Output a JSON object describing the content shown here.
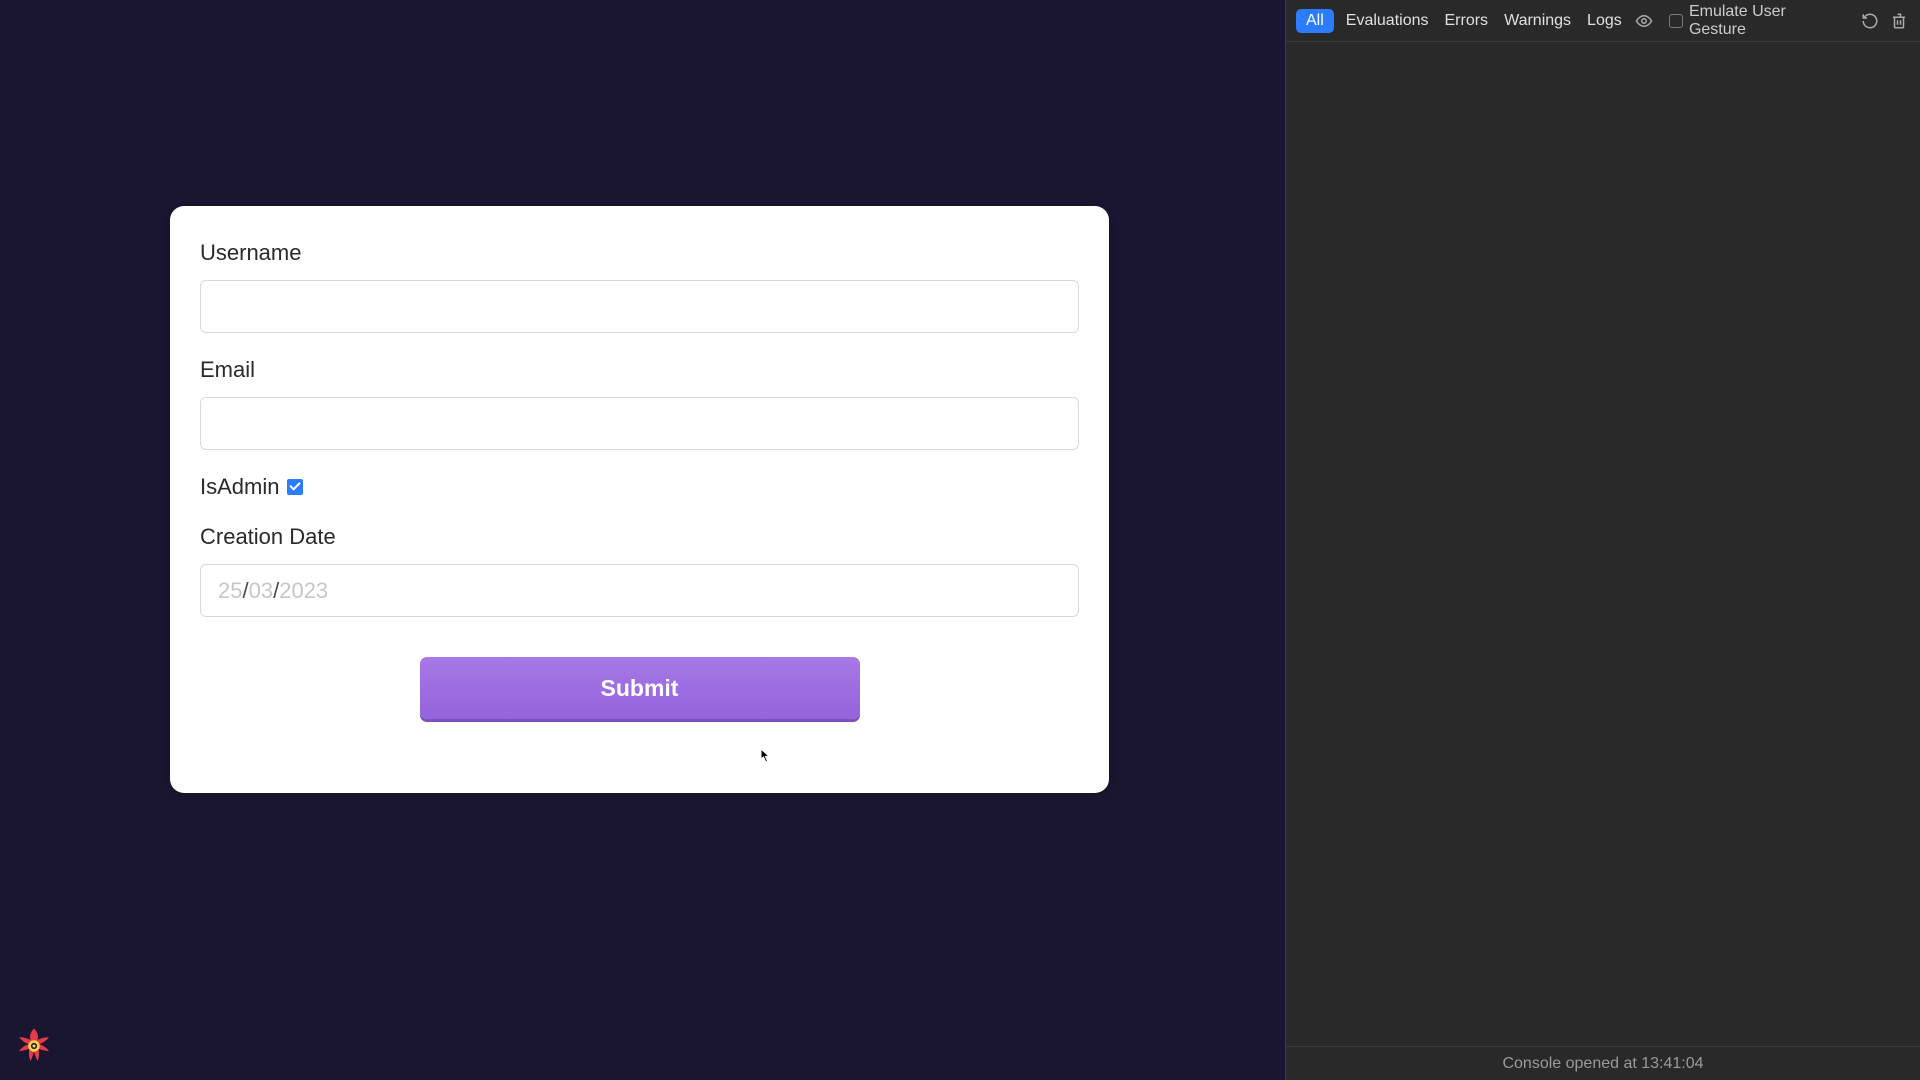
{
  "form": {
    "username_label": "Username",
    "username_value": "",
    "email_label": "Email",
    "email_value": "",
    "isadmin_label": "IsAdmin",
    "isadmin_checked": true,
    "date_label": "Creation Date",
    "date_value": "",
    "date_placeholder_day": "25",
    "date_placeholder_month": "03",
    "date_placeholder_year": "2023",
    "submit_label": "Submit"
  },
  "devtools": {
    "filters": {
      "all": "All",
      "evaluations": "Evaluations",
      "errors": "Errors",
      "warnings": "Warnings",
      "logs": "Logs"
    },
    "emulate_label": "Emulate User Gesture",
    "footer": "Console opened at 13:41:04"
  }
}
